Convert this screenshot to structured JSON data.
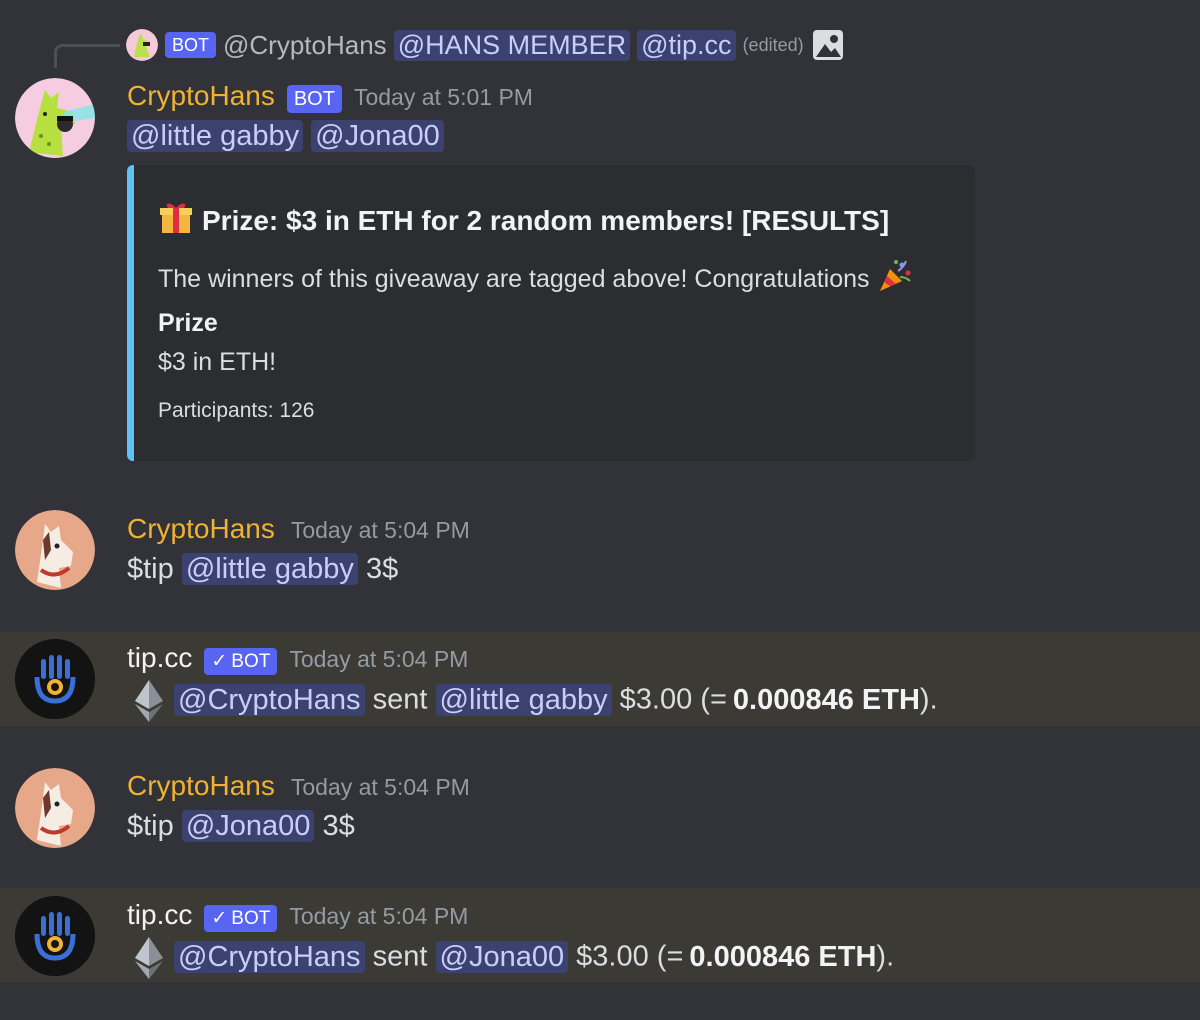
{
  "reply": {
    "bot_label": "BOT",
    "author": "@CryptoHans",
    "mentions": [
      "@HANS MEMBER",
      "@tip.cc"
    ],
    "edited": "(edited)"
  },
  "messages": [
    {
      "author": "CryptoHans",
      "bot_label": "BOT",
      "timestamp": "Today at 5:01 PM",
      "mentions": [
        "@little gabby",
        "@Jona00"
      ],
      "embed": {
        "title": "Prize: $3 in ETH for 2 random members!  [RESULTS]",
        "description": "The winners of this giveaway are tagged above! Congratulations",
        "field_name": "Prize",
        "field_value": "$3 in ETH!",
        "footer": "Participants: 126",
        "accent_color": "#5fc2f2"
      }
    },
    {
      "author": "CryptoHans",
      "timestamp": "Today at 5:04 PM",
      "prefix": "$tip",
      "mention": "@little gabby",
      "suffix": "3$"
    },
    {
      "author": "tip.cc",
      "bot_label": "BOT",
      "timestamp": "Today at 5:04 PM",
      "sender": "@CryptoHans",
      "verb": "sent",
      "recipient": "@little gabby",
      "amount": "$3.00 (=",
      "eth_amount": "0.000846 ETH",
      "close": ")."
    },
    {
      "author": "CryptoHans",
      "timestamp": "Today at 5:04 PM",
      "prefix": "$tip",
      "mention": "@Jona00",
      "suffix": "3$"
    },
    {
      "author": "tip.cc",
      "bot_label": "BOT",
      "timestamp": "Today at 5:04 PM",
      "sender": "@CryptoHans",
      "verb": "sent",
      "recipient": "@Jona00",
      "amount": "$3.00 (=",
      "eth_amount": "0.000846 ETH",
      "close": ")."
    }
  ],
  "colors": {
    "background": "#313338",
    "mention_bg": "#3c4270",
    "bot_badge": "#5865f2",
    "username": "#f0b232",
    "highlight_row": "#3c3a35"
  }
}
